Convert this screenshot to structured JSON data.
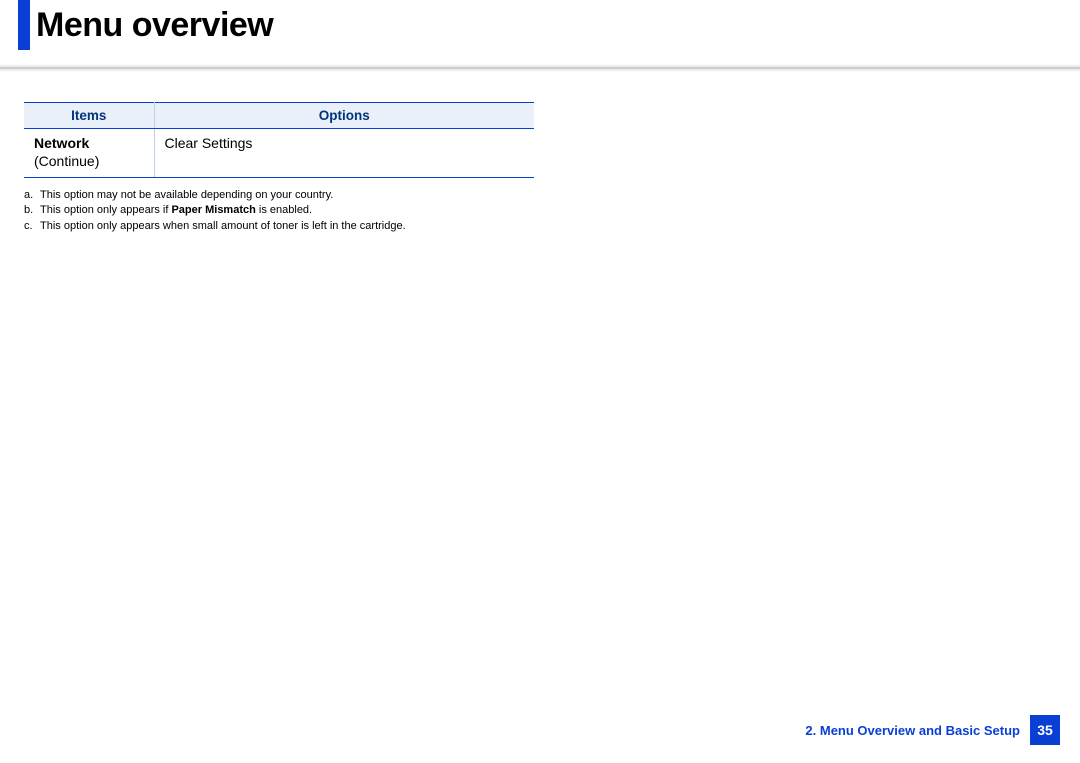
{
  "header": {
    "title": "Menu overview"
  },
  "table": {
    "headers": {
      "col1": "Items",
      "col2": "Options"
    },
    "row": {
      "item_name": "Network",
      "item_sub": "(Continue)",
      "option": "Clear Settings"
    }
  },
  "footnotes": {
    "a_marker": "a.",
    "a_text": "This option may not be available depending on your country.",
    "b_marker": "b.",
    "b_prefix": "This option only appears if ",
    "b_strong": "Paper Mismatch",
    "b_suffix": " is enabled.",
    "c_marker": "c.",
    "c_text": "This option only appears when small amount of toner is left in the cartridge."
  },
  "footer": {
    "section": "2. Menu Overview and Basic Setup",
    "page": "35"
  }
}
